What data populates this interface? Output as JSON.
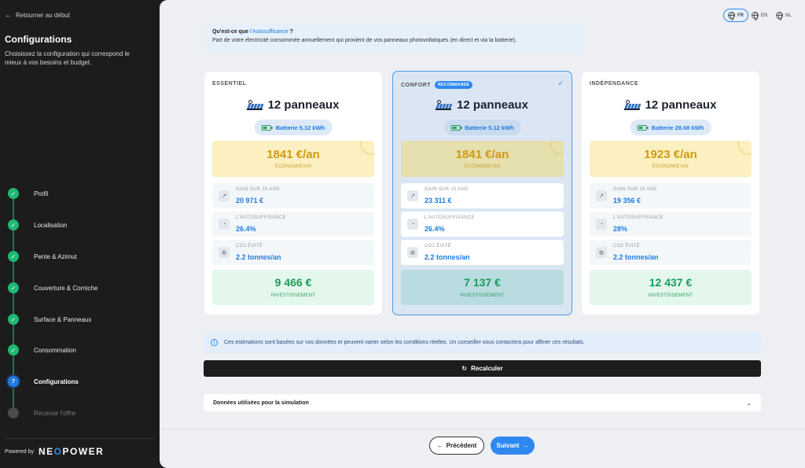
{
  "sidebar": {
    "back_label": "Retourner au début",
    "title": "Configurations",
    "description": "Choisissez la configuration qui correspond le mieux à vos besoins et budget.",
    "steps": [
      {
        "label": "Profil",
        "state": "done"
      },
      {
        "label": "Localisation",
        "state": "done"
      },
      {
        "label": "Pente & Azimut",
        "state": "done"
      },
      {
        "label": "Couverture & Corniche",
        "state": "done"
      },
      {
        "label": "Surface & Panneaux",
        "state": "done"
      },
      {
        "label": "Consommation",
        "state": "done"
      },
      {
        "label": "Configurations",
        "state": "current",
        "number": "7"
      },
      {
        "label": "Recevoir l'offre",
        "state": "todo"
      }
    ],
    "powered_by": "Powered by",
    "brand_pre": "NE",
    "brand_o": "O",
    "brand_post": "POWER"
  },
  "languages": [
    {
      "code": "FR",
      "active": true
    },
    {
      "code": "EN",
      "active": false
    },
    {
      "code": "NL",
      "active": false
    }
  ],
  "info_box": {
    "question_prefix": "Qu'est-ce que ",
    "question_highlight": "l'Autosuffisance",
    "question_suffix": " ?",
    "answer": "Part de votre électricité consommée annuellement qui provient de vos panneaux photovoltaïques (en direct et via la batterie)."
  },
  "cards": [
    {
      "name": "ESSENTIEL",
      "badge": "",
      "panels": "12 panneaux",
      "battery": "Batterie 5.12 kWh",
      "price": "1841 €/an",
      "price_label": "ÉCONOMIE/AN",
      "gain_label": "GAIN SUR 15 ANS",
      "gain_value": "20 971 €",
      "autosuff_label": "L'AUTOSUFFISANCE",
      "autosuff_value": "26.4%",
      "co2_label": "CO2 ÉVITÉ",
      "co2_value": "2.2 tonnes/an",
      "investment": "9 466 €",
      "investment_label": "INVESTISSEMENT"
    },
    {
      "name": "CONFORT",
      "badge": "RECOMMANDÉ",
      "panels": "12 panneaux",
      "battery": "Batterie 5.12 kWh",
      "price": "1841 €/an",
      "price_label": "ÉCONOMIE/AN",
      "gain_label": "GAIN SUR 15 ANS",
      "gain_value": "23 311 €",
      "autosuff_label": "L'AUTOSUFFISANCE",
      "autosuff_value": "26.4%",
      "co2_label": "CO2 ÉVITÉ",
      "co2_value": "2.2 tonnes/an",
      "investment": "7 137 €",
      "investment_label": "INVESTISSEMENT",
      "selected": true
    },
    {
      "name": "INDÉPENDANCE",
      "badge": "",
      "panels": "12 panneaux",
      "battery": "Batterie 28.68 kWh",
      "price": "1923 €/an",
      "price_label": "ÉCONOMIE/AN",
      "gain_label": "GAIN SUR 15 ANS",
      "gain_value": "19 356 €",
      "autosuff_label": "L'AUTOSUFFISANCE",
      "autosuff_value": "28%",
      "co2_label": "CO2 ÉVITÉ",
      "co2_value": "2.2 tonnes/an",
      "investment": "12 437 €",
      "investment_label": "INVESTISSEMENT"
    }
  ],
  "note": "Ces estimations sont basées sur vos données et peuvent varier selon les conditions réelles. Un conseiller vous contactera pour affiner ces résultats.",
  "recalc_label": "Recalculer",
  "accordion_label": "Données utilisées pour la simulation",
  "nav": {
    "prev_label": "Précédent",
    "next_label": "Suivant"
  },
  "colors": {
    "accent": "#2f88f0",
    "success": "#1fb873",
    "price": "#d09a12",
    "sidebar_bg": "#1c1c1c"
  }
}
